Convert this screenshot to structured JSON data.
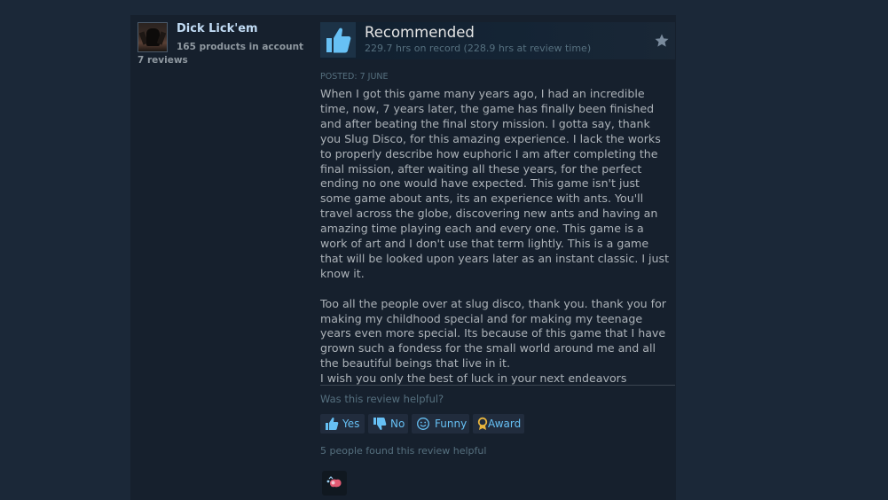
{
  "author": {
    "name": "Dick Lick'em",
    "products": "165 products in account",
    "reviews": "7 reviews",
    "avatar_icon": "avatar-image"
  },
  "review": {
    "verdict": "Recommended",
    "hours": "229.7 hrs on record (228.9 hrs at review time)",
    "posted": "POSTED: 7 JUNE",
    "paragraphs": [
      "When I got this game many years ago, I had an incredible time, now, 7 years later, the game has finally been finished and after beating the final story mission. I gotta say, thank you Slug Disco, for this amazing experience. I lack the works to properly describe how euphoric I am after completing the final mission, after waiting all these years, for the perfect ending no one would have expected. This game isn't just some game about ants, its an experience with ants. You'll travel across the globe, discovering new ants and having an amazing time playing each and every one. This game is a work of art and I don't use that term lightly. This is a game that will be looked upon years later as an instant classic. I just know it.",
      "Too all the people over at slug disco, thank you. thank you for making my childhood special and for making my teenage years even more special. Its because of this game that I have grown such a fondess for the small world around me and all the beautiful beings that live in it.\nI wish you only the best of luck in your next endeavors"
    ]
  },
  "feedback": {
    "question": "Was this review helpful?",
    "yes_label": "Yes",
    "no_label": "No",
    "funny_label": "Funny",
    "award_label": "Award",
    "helpful_count": "5 people found this review helpful"
  },
  "colors": {
    "page_bg": "#1b2838",
    "panel_bg": "#16202d",
    "link_blue": "#66c0f4",
    "body_text": "#acb2b8",
    "thumb_blue": "#67c1f5"
  },
  "icons": [
    "thumbs-up-icon",
    "star-icon",
    "thumbs-down-icon",
    "smiley-icon",
    "award-ribbon-icon",
    "award-badge-icon"
  ]
}
